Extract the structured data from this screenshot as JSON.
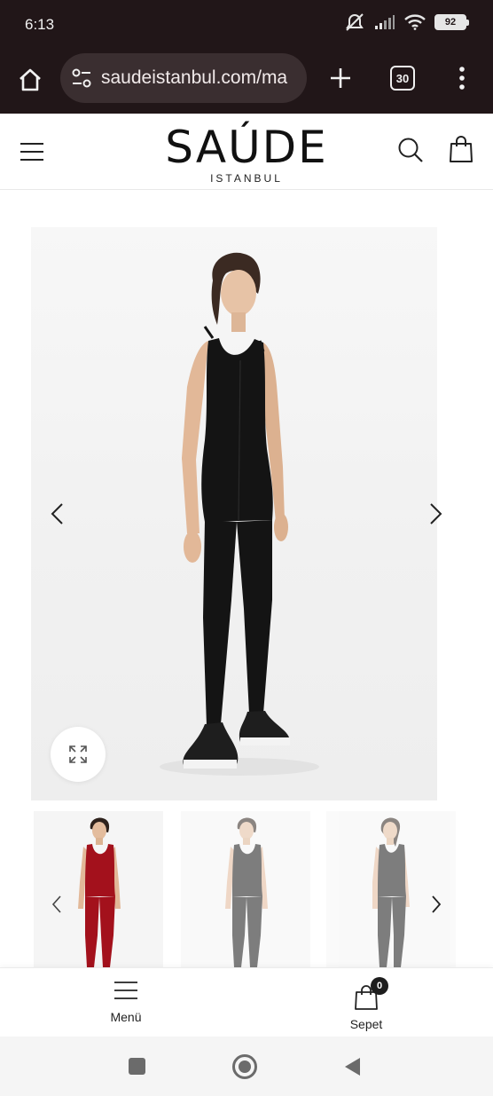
{
  "status_bar": {
    "time": "6:13",
    "battery": "92",
    "icons": [
      "mute-icon",
      "signal-icon",
      "wifi-icon",
      "battery-icon"
    ]
  },
  "browser": {
    "url": "saudeistanbul.com/ma",
    "tab_count": "30",
    "icons": [
      "home-icon",
      "site-settings-icon",
      "plus-icon",
      "tabs-icon",
      "kebab-menu-icon"
    ]
  },
  "site_header": {
    "logo_main": "SAÚDE",
    "logo_sub": "ISTANBUL",
    "icons": [
      "hamburger-icon",
      "search-icon",
      "shopping-bag-icon"
    ]
  },
  "product_gallery": {
    "main_image": "model-black-jumpsuit",
    "thumbnails": [
      "model-red-jumpsuit",
      "model-black-jumpsuit-front",
      "model-black-jumpsuit-side"
    ],
    "icons": [
      "chevron-left-icon",
      "chevron-right-icon",
      "expand-icon"
    ],
    "colors": {
      "jumpsuit_black": "#141414",
      "jumpsuit_red": "#a3111c",
      "background": "#f3f3f3"
    }
  },
  "bottom_nav": {
    "menu_label": "Menü",
    "cart_label": "Sepet",
    "cart_count": "0"
  },
  "android_nav": {
    "icons": [
      "recents-icon",
      "home-icon",
      "back-icon"
    ]
  }
}
